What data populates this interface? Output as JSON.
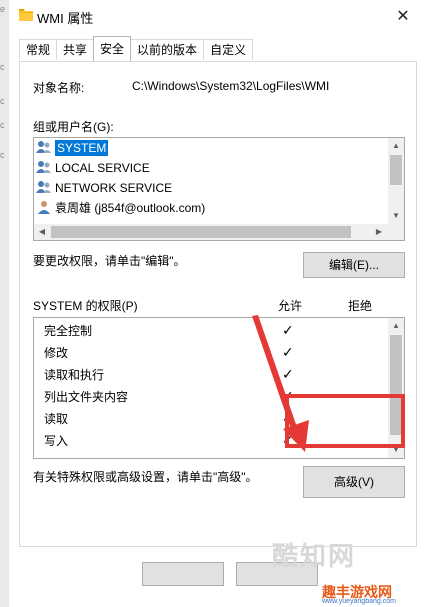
{
  "window": {
    "title": "WMI 属性",
    "close_glyph": "✕"
  },
  "tabs": [
    "常规",
    "共享",
    "安全",
    "以前的版本",
    "自定义"
  ],
  "active_tab": "安全",
  "object": {
    "label": "对象名称:",
    "value": "C:\\Windows\\System32\\LogFiles\\WMI"
  },
  "groups": {
    "label": "组或用户名(G):",
    "items": [
      {
        "name": "SYSTEM",
        "selected": true,
        "icon": "group-icon"
      },
      {
        "name": "LOCAL SERVICE",
        "selected": false,
        "icon": "group-icon"
      },
      {
        "name": "NETWORK SERVICE",
        "selected": false,
        "icon": "group-icon"
      },
      {
        "name": "袁周雄 (j854f@outlook.com)",
        "selected": false,
        "icon": "user-icon"
      }
    ]
  },
  "edit": {
    "hint": "要更改权限，请单击\"编辑\"。",
    "button": "编辑(E)..."
  },
  "permissions": {
    "header": "SYSTEM 的权限(P)",
    "allow_header": "允许",
    "deny_header": "拒绝",
    "rows": [
      {
        "name": "完全控制",
        "allow": true,
        "deny": false
      },
      {
        "name": "修改",
        "allow": true,
        "deny": false
      },
      {
        "name": "读取和执行",
        "allow": true,
        "deny": false
      },
      {
        "name": "列出文件夹内容",
        "allow": true,
        "deny": false
      },
      {
        "name": "读取",
        "allow": true,
        "deny": false
      },
      {
        "name": "写入",
        "allow": true,
        "deny": false
      }
    ],
    "check_glyph": "✓"
  },
  "advanced": {
    "hint": "有关特殊权限或高级设置，请单击\"高级\"。",
    "button": "高级(V)"
  },
  "annotation": {
    "color": "#e53935"
  },
  "watermark": {
    "brand": "酷知网",
    "site": "趣丰游戏网",
    "url": "www.yueyangbang.com"
  }
}
